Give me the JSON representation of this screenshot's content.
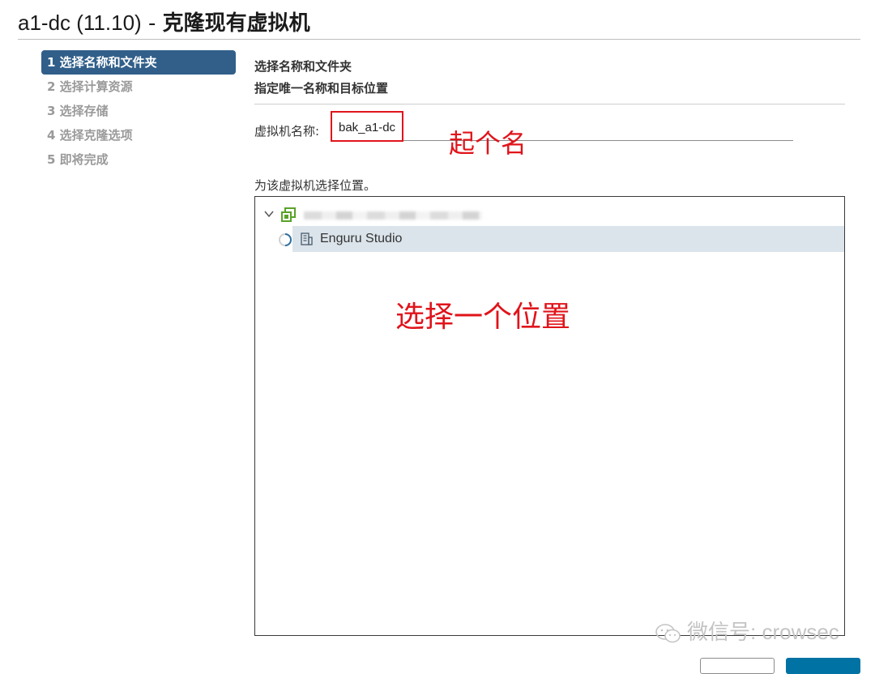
{
  "window": {
    "vm_name": "a1-dc (11.10)",
    "separator": " - ",
    "action": "克隆现有虚拟机"
  },
  "steps": [
    {
      "label": "1 选择名称和文件夹",
      "active": true
    },
    {
      "label": "2 选择计算资源",
      "active": false
    },
    {
      "label": "3 选择存储",
      "active": false
    },
    {
      "label": "4 选择克隆选项",
      "active": false
    },
    {
      "label": "5 即将完成",
      "active": false
    }
  ],
  "content": {
    "heading": "选择名称和文件夹",
    "subheading": "指定唯一名称和目标位置",
    "name_label": "虚拟机名称:",
    "name_value": "bak_a1-dc",
    "location_label": "为该虚拟机选择位置。",
    "tree": {
      "folder_label": "Enguru Studio"
    }
  },
  "annotations": {
    "name_hint": "起个名",
    "location_hint": "选择一个位置",
    "color": "#e0141b"
  },
  "watermark": "微信号: crowsec",
  "colors": {
    "active_step": "#315f8a",
    "selected_row": "#dbe4eb",
    "datacenter_icon": "#5aa228",
    "primary_button": "#0072a3"
  }
}
